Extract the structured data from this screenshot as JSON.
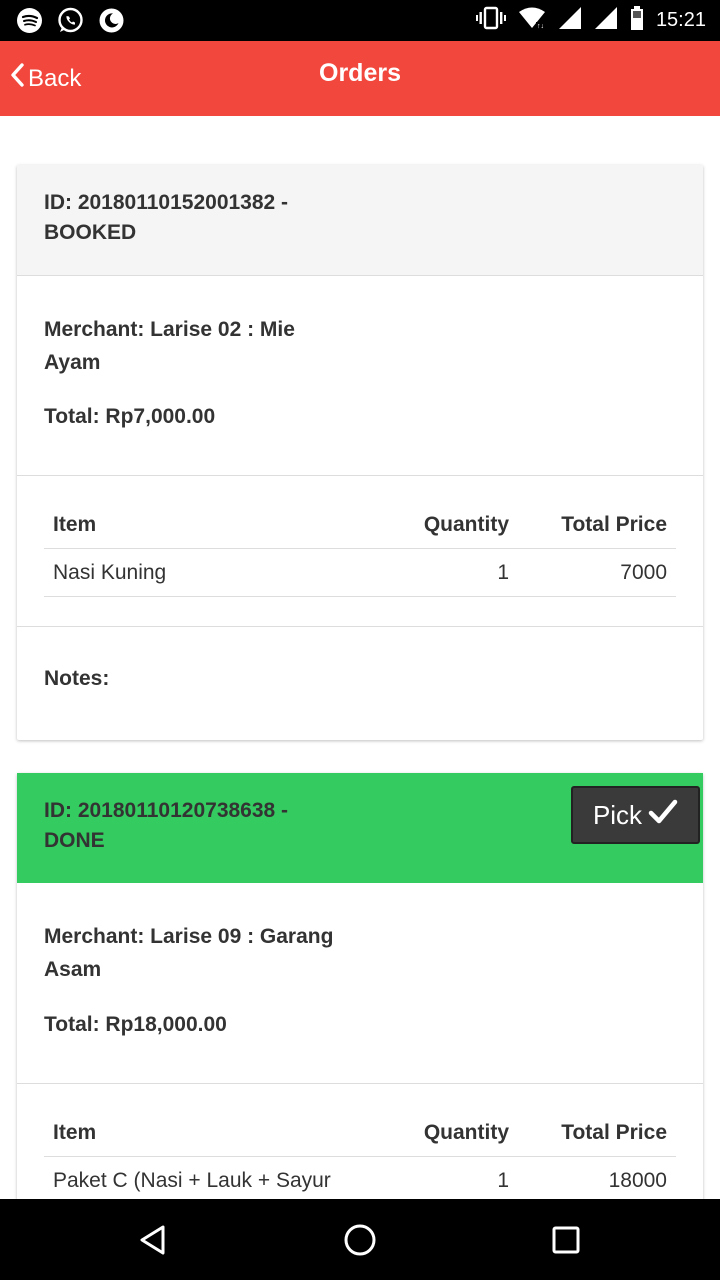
{
  "status_bar": {
    "time": "15:21",
    "left_icons": [
      "spotify-icon",
      "whatsapp-icon",
      "moon-icon"
    ],
    "right_icons": [
      "vibrate-icon",
      "wifi-icon",
      "signal-icon",
      "signal-icon",
      "battery-icon"
    ]
  },
  "app_bar": {
    "back_label": "Back",
    "title": "Orders",
    "color": "#f2473c"
  },
  "orders": [
    {
      "id_line": "ID: 20180110152001382 -",
      "status": "BOOKED",
      "header_color": "#f5f5f5",
      "merchant_line1": "Merchant: Larise 02 : Mie",
      "merchant_line2": "Ayam",
      "total": "Total: Rp7,000.00",
      "table_headers": {
        "item": "Item",
        "quantity": "Quantity",
        "price": "Total Price"
      },
      "rows": [
        {
          "item": "Nasi Kuning",
          "quantity": "1",
          "price": "7000"
        }
      ],
      "notes_label": "Notes:"
    },
    {
      "id_line": "ID: 20180110120738638 -",
      "status": "DONE",
      "header_color": "#34cc60",
      "pick_label": "Pick",
      "merchant_line1": "Merchant: Larise 09 : Garang",
      "merchant_line2": "Asam",
      "total": "Total: Rp18,000.00",
      "table_headers": {
        "item": "Item",
        "quantity": "Quantity",
        "price": "Total Price"
      },
      "rows": [
        {
          "item": "Paket C (Nasi + Lauk + Sayur",
          "quantity": "1",
          "price": "18000"
        }
      ]
    }
  ],
  "nav_bar": {
    "buttons": [
      "back-triangle-icon",
      "home-circle-icon",
      "recents-square-icon"
    ]
  }
}
